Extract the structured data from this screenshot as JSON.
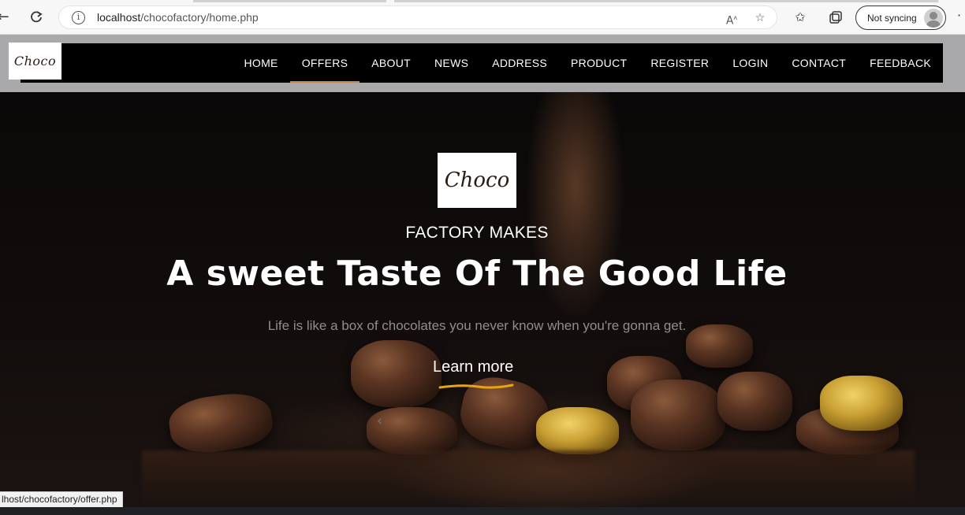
{
  "browser": {
    "url_host": "localhost",
    "url_path": "/chocofactory/home.php",
    "sync_label": "Not syncing",
    "status_url": "lhost/chocofactory/offer.php",
    "icons": [
      "back-icon",
      "refresh-icon",
      "info-icon",
      "read-aloud-icon",
      "add-favorite-icon",
      "favorites-icon",
      "collections-icon",
      "profile-icon",
      "more-icon"
    ]
  },
  "site": {
    "logo_text": "Choco",
    "nav": [
      {
        "label": "HOME"
      },
      {
        "label": "OFFERS",
        "active": true
      },
      {
        "label": "ABOUT"
      },
      {
        "label": "NEWS"
      },
      {
        "label": "ADDRESS"
      },
      {
        "label": "PRODUCT"
      },
      {
        "label": "REGISTER"
      },
      {
        "label": "LOGIN"
      },
      {
        "label": "CONTACT"
      },
      {
        "label": "FEEDBACK"
      }
    ],
    "accent_color": "#b98a52"
  },
  "hero": {
    "logo_text": "Choco",
    "eyebrow": "FACTORY MAKES",
    "title": "A sweet Taste Of The Good Life",
    "subtitle": "Life is like a box of chocolates you never know when you're gonna get.",
    "cta_label": "Learn more",
    "cta_underline_color": "#e8a512"
  }
}
